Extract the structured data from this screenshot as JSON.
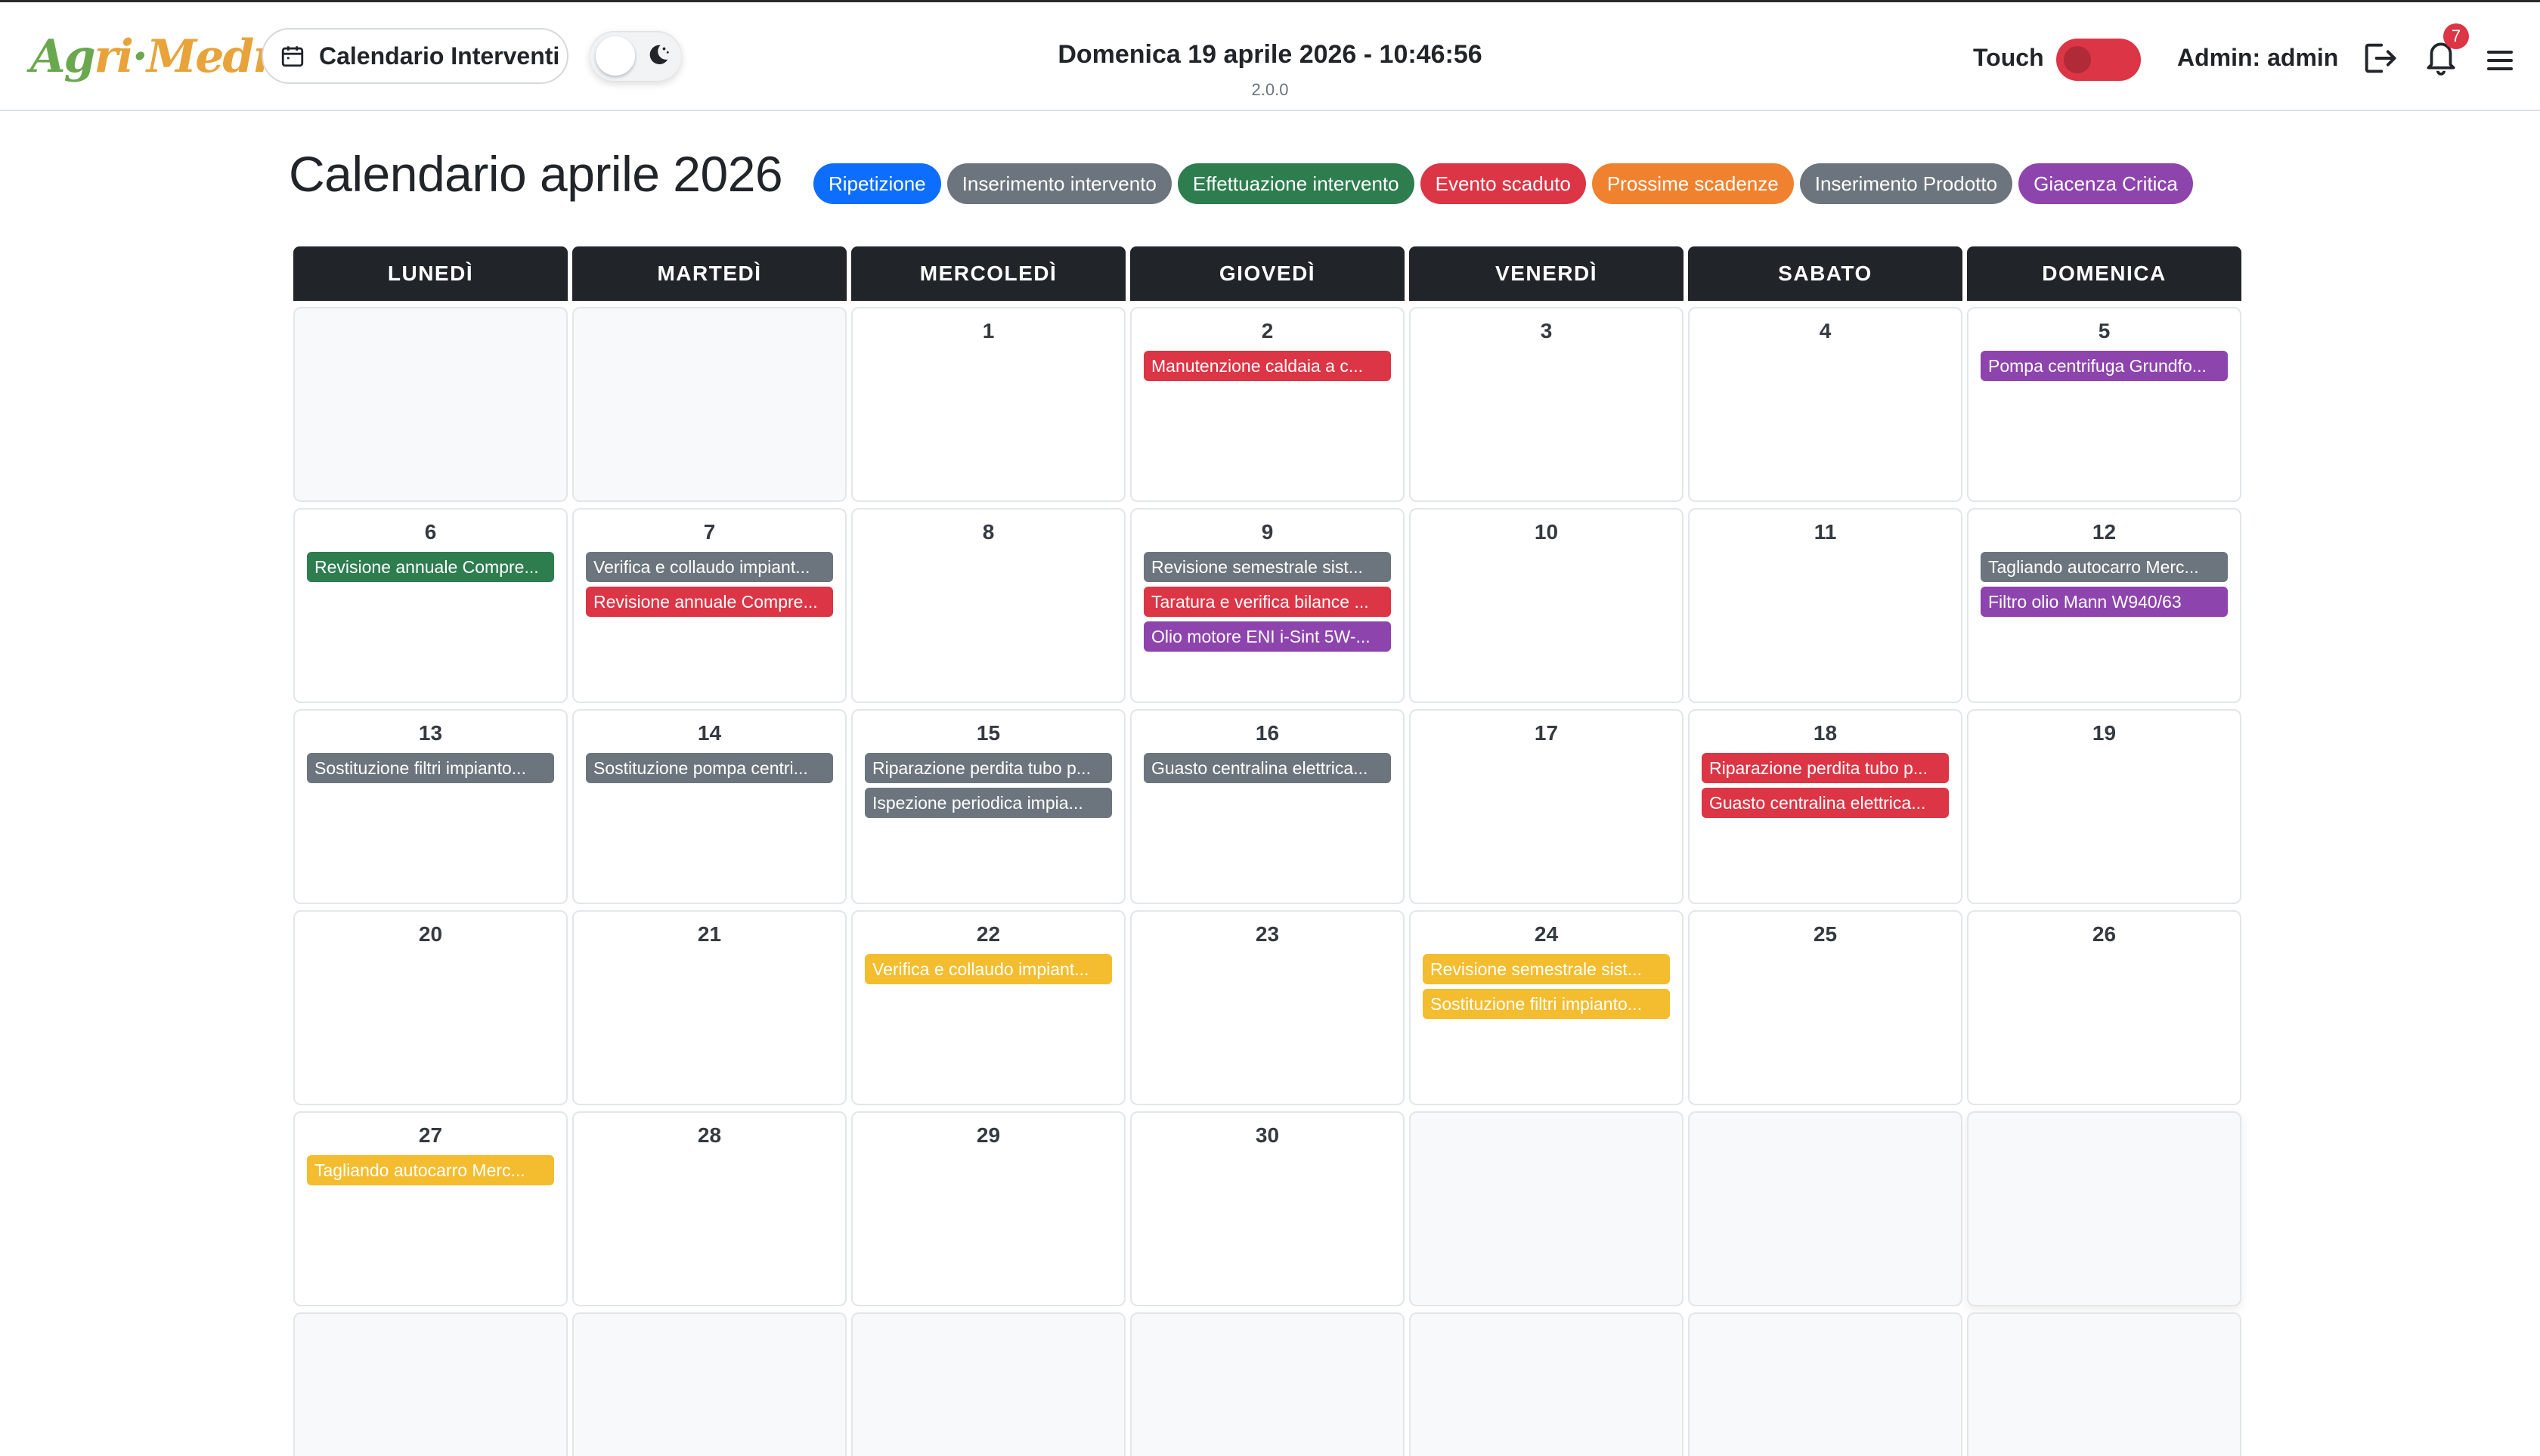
{
  "header": {
    "logo_text": "Agri-Medma",
    "page_button_label": "Calendario Interventi",
    "datetime": "Domenica 19 aprile 2026 - 10:46:56",
    "version": "2.0.0",
    "touch_label": "Touch",
    "touch_enabled": false,
    "admin_label": "Admin: admin",
    "notification_count": "7"
  },
  "calendar": {
    "title": "Calendario aprile 2026",
    "legend": [
      {
        "label": "Ripetizione",
        "color": "#0d6efd"
      },
      {
        "label": "Inserimento intervento",
        "color": "#6c757d"
      },
      {
        "label": "Effettuazione intervento",
        "color": "#2e7d4f"
      },
      {
        "label": "Evento scaduto",
        "color": "#dc3545"
      },
      {
        "label": "Prossime scadenze",
        "color": "#f0822f"
      },
      {
        "label": "Inserimento Prodotto",
        "color": "#6c757d"
      },
      {
        "label": "Giacenza Critica",
        "color": "#8e44ad"
      }
    ],
    "weekdays": [
      "LUNEDÌ",
      "MARTEDÌ",
      "MERCOLEDÌ",
      "GIOVEDÌ",
      "VENERDÌ",
      "SABATO",
      "DOMENICA"
    ],
    "weeks": [
      [
        {
          "day": "",
          "events": []
        },
        {
          "day": "",
          "events": []
        },
        {
          "day": "1",
          "events": []
        },
        {
          "day": "2",
          "events": [
            {
              "text": "Manutenzione caldaia a c...",
              "color": "red"
            }
          ]
        },
        {
          "day": "3",
          "events": []
        },
        {
          "day": "4",
          "events": []
        },
        {
          "day": "5",
          "events": [
            {
              "text": "Pompa centrifuga Grundfo...",
              "color": "purple"
            }
          ]
        }
      ],
      [
        {
          "day": "6",
          "events": [
            {
              "text": "Revisione annuale Compre...",
              "color": "green"
            }
          ]
        },
        {
          "day": "7",
          "events": [
            {
              "text": "Verifica e collaudo impiant...",
              "color": "gray"
            },
            {
              "text": "Revisione annuale Compre...",
              "color": "red"
            }
          ]
        },
        {
          "day": "8",
          "events": []
        },
        {
          "day": "9",
          "events": [
            {
              "text": "Revisione semestrale sist...",
              "color": "gray"
            },
            {
              "text": "Taratura e verifica bilance ...",
              "color": "red"
            },
            {
              "text": "Olio motore ENI i-Sint 5W-...",
              "color": "purple"
            }
          ]
        },
        {
          "day": "10",
          "events": []
        },
        {
          "day": "11",
          "events": []
        },
        {
          "day": "12",
          "events": [
            {
              "text": "Tagliando autocarro Merc...",
              "color": "gray"
            },
            {
              "text": "Filtro olio Mann W940/63",
              "color": "purple"
            }
          ]
        }
      ],
      [
        {
          "day": "13",
          "events": [
            {
              "text": "Sostituzione filtri impianto...",
              "color": "gray"
            }
          ]
        },
        {
          "day": "14",
          "events": [
            {
              "text": "Sostituzione pompa centri...",
              "color": "gray"
            }
          ]
        },
        {
          "day": "15",
          "events": [
            {
              "text": "Riparazione perdita tubo p...",
              "color": "gray"
            },
            {
              "text": "Ispezione periodica impia...",
              "color": "gray"
            }
          ]
        },
        {
          "day": "16",
          "events": [
            {
              "text": "Guasto centralina elettrica...",
              "color": "gray"
            }
          ]
        },
        {
          "day": "17",
          "events": []
        },
        {
          "day": "18",
          "events": [
            {
              "text": "Riparazione perdita tubo p...",
              "color": "red"
            },
            {
              "text": "Guasto centralina elettrica...",
              "color": "red"
            }
          ]
        },
        {
          "day": "19",
          "events": []
        }
      ],
      [
        {
          "day": "20",
          "events": []
        },
        {
          "day": "21",
          "events": []
        },
        {
          "day": "22",
          "events": [
            {
              "text": "Verifica e collaudo impiant...",
              "color": "yellow"
            }
          ]
        },
        {
          "day": "23",
          "events": []
        },
        {
          "day": "24",
          "events": [
            {
              "text": "Revisione semestrale sist...",
              "color": "yellow"
            },
            {
              "text": "Sostituzione filtri impianto...",
              "color": "yellow"
            }
          ]
        },
        {
          "day": "25",
          "events": []
        },
        {
          "day": "26",
          "events": []
        }
      ],
      [
        {
          "day": "27",
          "events": [
            {
              "text": "Tagliando autocarro Merc...",
              "color": "yellow"
            }
          ]
        },
        {
          "day": "28",
          "events": []
        },
        {
          "day": "29",
          "events": []
        },
        {
          "day": "30",
          "events": []
        },
        {
          "day": "",
          "events": []
        },
        {
          "day": "",
          "events": []
        },
        {
          "day": "",
          "events": []
        }
      ],
      [
        {
          "day": "",
          "events": []
        },
        {
          "day": "",
          "events": []
        },
        {
          "day": "",
          "events": []
        },
        {
          "day": "",
          "events": []
        },
        {
          "day": "",
          "events": []
        },
        {
          "day": "",
          "events": []
        },
        {
          "day": "",
          "events": []
        }
      ]
    ]
  }
}
